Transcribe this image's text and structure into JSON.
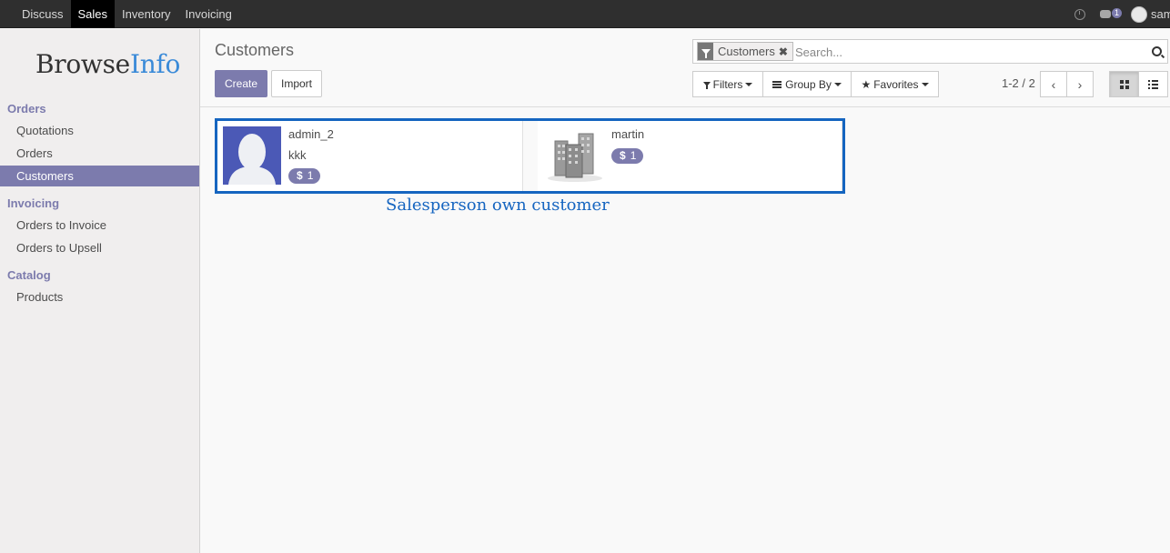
{
  "topbar": {
    "menu": [
      "Discuss",
      "Sales",
      "Inventory",
      "Invoicing"
    ],
    "active_menu": "Sales",
    "chat_count": "1",
    "user_name": "sam"
  },
  "sidebar": {
    "logo": {
      "part1": "Browse",
      "part2": "Info"
    },
    "sections": [
      {
        "title": "Orders",
        "items": [
          "Quotations",
          "Orders",
          "Customers"
        ]
      },
      {
        "title": "Invoicing",
        "items": [
          "Orders to Invoice",
          "Orders to Upsell"
        ]
      },
      {
        "title": "Catalog",
        "items": [
          "Products"
        ]
      }
    ],
    "active_item": "Customers"
  },
  "control_panel": {
    "title": "Customers",
    "create_label": "Create",
    "import_label": "Import",
    "search": {
      "facet_value": "Customers",
      "placeholder": "Search..."
    },
    "filters_label": "Filters",
    "groupby_label": "Group By",
    "favorites_label": "Favorites",
    "pager": "1-2 / 2"
  },
  "kanban": {
    "records": [
      {
        "name": "admin_2",
        "subtitle": "kkk",
        "badge": "1",
        "image": "person-avatar"
      },
      {
        "name": "martin",
        "subtitle": "",
        "badge": "1",
        "image": "company-buildings"
      }
    ],
    "annotation": "Salesperson own customer"
  },
  "colors": {
    "brand": "#7c7bad",
    "topbar": "#2f2f2f",
    "annotation": "#1565c0",
    "logo_accent": "#3a8ad8"
  }
}
